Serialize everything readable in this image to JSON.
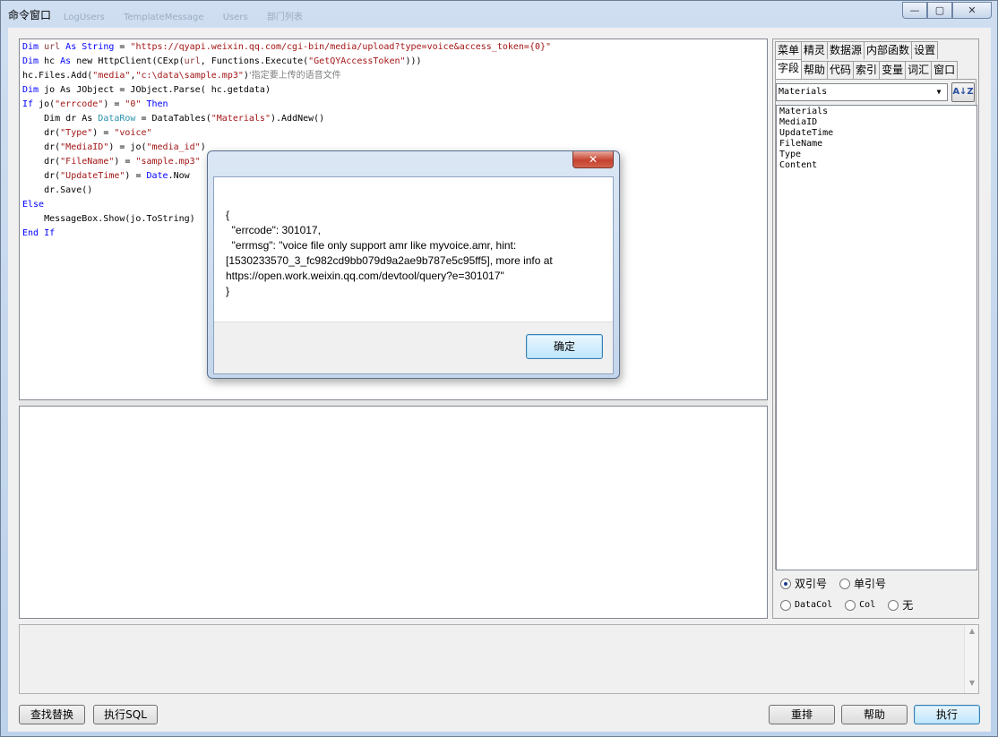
{
  "window": {
    "title": "命令窗口",
    "ghost_tabs": [
      "LogUsers",
      "TemplateMessage",
      "Users",
      "部门列表"
    ],
    "controls": {
      "minimize": "—",
      "maximize": "▢",
      "close": "✕"
    }
  },
  "code": {
    "l1": {
      "a": "Dim ",
      "b": "url",
      "c": " As ",
      "d": "String",
      "e": " = ",
      "f": "\"https://qyapi.weixin.qq.com/cgi-bin/media/upload?type=voice&access_token={0}\""
    },
    "l2": {
      "a": "Dim ",
      "b": "hc",
      "c": " As ",
      "d": "new HttpClient(CExp(",
      "e": "url",
      "f": ", Functions.Execute(",
      "g": "\"GetQYAccessToken\"",
      "h": ")))"
    },
    "l3": {
      "a": "hc.Files.Add(",
      "b": "\"media\"",
      "c": ",",
      "d": "\"c:\\data\\sample.mp3\"",
      "e": ")",
      "f": "'指定要上传的语音文件"
    },
    "l4": {
      "a": "Dim ",
      "b": "jo",
      "c": " As JObject = JObject.Parse( hc.getdata)"
    },
    "l5": {
      "a": "If ",
      "b": "jo(",
      "c": "\"errcode\"",
      "d": ") = ",
      "e": "\"0\"",
      "f": " Then"
    },
    "l6": {
      "a": "    Dim dr As ",
      "b": "DataRow",
      "c": " = DataTables(",
      "d": "\"Materials\"",
      "e": ").AddNew()"
    },
    "l7": {
      "a": "    dr(",
      "b": "\"Type\"",
      "c": ") = ",
      "d": "\"voice\""
    },
    "l8": {
      "a": "    dr(",
      "b": "\"MediaID\"",
      "c": ") = jo(",
      "d": "\"media_id\"",
      "e": ")"
    },
    "l9": {
      "a": "    dr(",
      "b": "\"FileName\"",
      "c": ") = ",
      "d": "\"sample.mp3\""
    },
    "l10": {
      "a": "    dr(",
      "b": "\"UpdateTime\"",
      "c": ") = ",
      "d": "Date",
      "e": ".Now"
    },
    "l11": "    dr.Save()",
    "l12": "Else",
    "l13": "    MessageBox.Show(jo.ToString)",
    "l14": "End If"
  },
  "right_panel": {
    "tabs_row1": [
      "菜单",
      "精灵",
      "数据源",
      "内部函数",
      "设置"
    ],
    "tabs_row2": [
      "字段",
      "帮助",
      "代码",
      "索引",
      "变量",
      "词汇",
      "窗口"
    ],
    "active_tab": "字段",
    "table_select": "Materials",
    "sort_button": "A↓Z",
    "fields": [
      "Materials",
      "MediaID",
      "UpdateTime",
      "FileName",
      "Type",
      "Content"
    ],
    "quote_options": [
      "双引号",
      "单引号"
    ],
    "col_options": [
      "DataCol",
      "Col",
      "无"
    ]
  },
  "buttons": {
    "find_replace": "查找替换",
    "exec_sql": "执行SQL",
    "rearrange": "重排",
    "help": "帮助",
    "execute": "执行"
  },
  "dialog": {
    "close": "✕",
    "message_lines": [
      "{",
      "  \"errcode\": 301017,",
      "  \"errmsg\": \"voice file only support amr like myvoice.amr, hint:",
      "[1530233570_3_fc982cd9bb079d9a2ae9b787e5c95ff5], more info at",
      "https://open.work.weixin.qq.com/devtool/query?e=301017\"",
      "}"
    ],
    "ok": "确定"
  }
}
